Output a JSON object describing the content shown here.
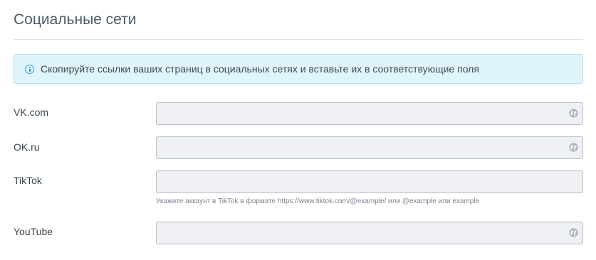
{
  "section": {
    "title": "Социальные сети"
  },
  "info": {
    "icon": "info-icon",
    "text": "Скопируйте ссылки ваших страниц в социальных сетях и вставьте их в соответствующие поля",
    "colors": {
      "background": "#dff4fb",
      "border": "#b2e3f3",
      "icon": "#2a9fd6"
    }
  },
  "fields": {
    "vk": {
      "label": "VK.com",
      "value": "",
      "icon": "globe-icon"
    },
    "ok": {
      "label": "OK.ru",
      "value": "",
      "icon": "globe-icon"
    },
    "tiktok": {
      "label": "TikTok",
      "value": "",
      "help": "Укажите аккаунт в TikTok в формате https://www.tiktok.com/@example/ или @example или example"
    },
    "youtube": {
      "label": "YouTube",
      "value": "",
      "icon": "globe-icon"
    }
  }
}
